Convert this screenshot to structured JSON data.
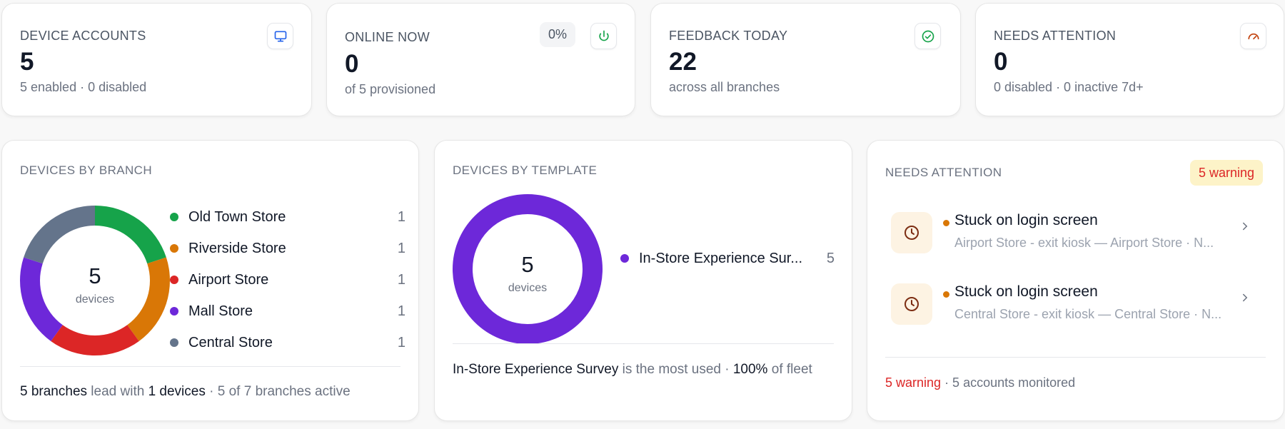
{
  "stats": [
    {
      "label": "DEVICE ACCOUNTS",
      "value": "5",
      "sub": "5 enabled · 0 disabled",
      "icon": "monitor-icon"
    },
    {
      "label": "ONLINE NOW",
      "value": "0",
      "sub": "of 5 provisioned",
      "pill": "0%",
      "icon": "power-icon"
    },
    {
      "label": "FEEDBACK TODAY",
      "value": "22",
      "sub": "across all branches",
      "icon": "check-circle-icon"
    },
    {
      "label": "NEEDS ATTENTION",
      "value": "0",
      "sub": "0 disabled · 0 inactive 7d+",
      "icon": "gauge-icon"
    }
  ],
  "branch_section": {
    "title": "DEVICES BY BRANCH",
    "center_value": "5",
    "center_label": "devices",
    "legend": [
      {
        "name": "Old Town Store",
        "count": "1",
        "color": "#16a34a"
      },
      {
        "name": "Riverside Store",
        "count": "1",
        "color": "#d97706"
      },
      {
        "name": "Airport Store",
        "count": "1",
        "color": "#dc2626"
      },
      {
        "name": "Mall Store",
        "count": "1",
        "color": "#6d28d9"
      },
      {
        "name": "Central Store",
        "count": "1",
        "color": "#64748b"
      }
    ],
    "footer": {
      "lead_count": "5 branches",
      "lead_text": "lead with",
      "lead_devices": "1 devices",
      "active": "· 5 of 7 branches active"
    }
  },
  "template_section": {
    "title": "DEVICES BY TEMPLATE",
    "center_value": "5",
    "center_label": "devices",
    "legend": [
      {
        "name": "In-Store Experience Sur...",
        "count": "5",
        "color": "#6d28d9"
      }
    ],
    "footer": {
      "template_name": "In-Store Experience Survey",
      "middle": "is the most used ·",
      "percent": "100%",
      "tail": "of fleet"
    }
  },
  "attention_section": {
    "title": "NEEDS ATTENTION",
    "badge": "5 warning",
    "items": [
      {
        "title": "Stuck on login screen",
        "sub": "Airport Store - exit kiosk — Airport Store · N...",
        "icon": "clock-icon"
      },
      {
        "title": "Stuck on login screen",
        "sub": "Central Store - exit kiosk — Central Store · N...",
        "icon": "clock-icon"
      }
    ],
    "footer_warning": "5 warning",
    "footer_rest": "· 5 accounts monitored"
  },
  "chart_data": [
    {
      "type": "pie",
      "categories": [
        "Old Town Store",
        "Riverside Store",
        "Airport Store",
        "Mall Store",
        "Central Store"
      ],
      "values": [
        1,
        1,
        1,
        1,
        1
      ],
      "colors": [
        "#16a34a",
        "#d97706",
        "#dc2626",
        "#6d28d9",
        "#64748b"
      ],
      "title": "DEVICES BY BRANCH"
    },
    {
      "type": "pie",
      "categories": [
        "In-Store Experience Survey"
      ],
      "values": [
        5
      ],
      "colors": [
        "#6d28d9"
      ],
      "title": "DEVICES BY TEMPLATE"
    }
  ]
}
